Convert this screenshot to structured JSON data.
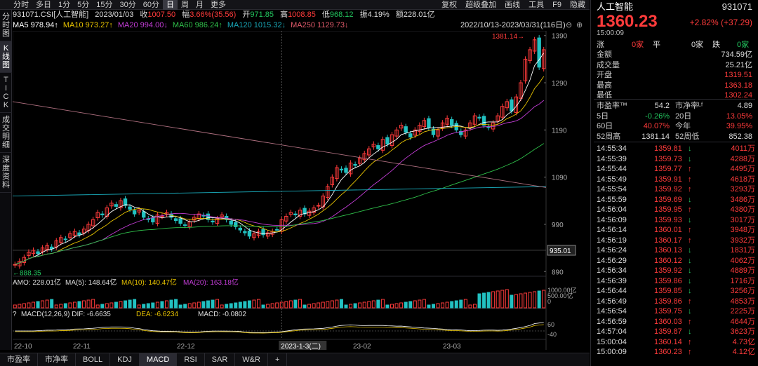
{
  "period_tabs": [
    "分时",
    "多日",
    "1分",
    "5分",
    "15分",
    "30分",
    "60分",
    "日",
    "周",
    "月",
    "更多"
  ],
  "active_period": "日",
  "toolbar": [
    "复权",
    "超级叠加",
    "画线",
    "工具",
    "F9",
    "隐藏"
  ],
  "left_nav": [
    "分\n时\n图",
    "K\n线\n图",
    "T\nI\nC\nK",
    "成\n交\n明\n细",
    "深\n度\n资\n料"
  ],
  "info": {
    "code": "931071.CSI[人工智能]",
    "date": "2023/01/03",
    "close_label": "收",
    "close": "1007.50",
    "amp_label": "幅",
    "amp": "3.66%(35.56)",
    "open_label": "开",
    "open": "971.85",
    "high_label": "高",
    "high": "1008.85",
    "low_label": "低",
    "low": "968.12",
    "swing": "振4.19%",
    "amount": "额228.01亿"
  },
  "ma": {
    "ma5": "MA5 978.94↑",
    "ma10": "MA10 973.27↑",
    "ma20": "MA20 994.00↓",
    "ma60": "MA60 986.24↑",
    "ma120": "MA120 1015.32↓",
    "ma250": "MA250 1129.73↓"
  },
  "range_label": "2022/10/13-2023/03/31(116日)",
  "price_axis": [
    "1390",
    "1290",
    "1190",
    "1090",
    "990",
    "890"
  ],
  "current_price_tag": "935.01",
  "high_annot": "1381.14",
  "low_annot": "888.35",
  "amo": {
    "amo": "AMO: 228.01亿",
    "ma5": "MA(5): 148.64亿",
    "ma10": "MA(10): 140.47亿",
    "ma20": "MA(20): 163.18亿"
  },
  "vol_axis": [
    "1000.00亿",
    "500.00亿",
    "0"
  ],
  "macd": {
    "q": "?",
    "label": "MACD(12,26,9) DIF: -6.6635",
    "dea": "DEA: -6.6234",
    "macd": "MACD: -0.0802"
  },
  "macd_axis": [
    "60",
    "-40"
  ],
  "date_axis": [
    "22-10",
    "22-11",
    "22-12",
    "23-02",
    "23-03"
  ],
  "date_highlight": "2023-1-3(二)",
  "bottom_tabs": [
    "市盈率",
    "市净率",
    "BOLL",
    "KDJ",
    "MACD",
    "RSI",
    "SAR",
    "W&R",
    "+"
  ],
  "active_bottom": "MACD",
  "stock": {
    "name": "人工智能",
    "code": "931071",
    "price": "1360.23",
    "change": "+2.82%",
    "change_pts": "(+37.29)",
    "time": "15:00:09"
  },
  "stats": {
    "zhang": "涨",
    "zhang_v": "0家",
    "ping": "平",
    "ping_v": "0家",
    "die": "跌",
    "die_v": "0家",
    "rows": [
      [
        "金额",
        "734.59亿"
      ],
      [
        "成交量",
        "25.21亿"
      ],
      [
        "开盘",
        "1319.51"
      ],
      [
        "最高",
        "1363.18"
      ],
      [
        "最低",
        "1302.24"
      ]
    ],
    "pe": "市盈率™",
    "pe_v": "54.2",
    "pb": "市净率ᴸᶠ",
    "pb_v": "4.89",
    "d5": "5日",
    "d5_v": "-0.26%",
    "d20": "20日",
    "d20_v": "13.05%",
    "d60": "60日",
    "d60_v": "40.07%",
    "ytd": "今年",
    "ytd_v": "39.95%",
    "w52h": "52周高",
    "w52h_v": "1381.14",
    "w52l": "52周低",
    "w52l_v": "852.38"
  },
  "ticks": [
    [
      "14:55:34",
      "1359.81",
      "↓",
      "4011万"
    ],
    [
      "14:55:39",
      "1359.73",
      "↓",
      "4288万"
    ],
    [
      "14:55:44",
      "1359.77",
      "↑",
      "4495万"
    ],
    [
      "14:55:49",
      "1359.91",
      "↑",
      "4618万"
    ],
    [
      "14:55:54",
      "1359.92",
      "↑",
      "3293万"
    ],
    [
      "14:55:59",
      "1359.69",
      "↓",
      "3486万"
    ],
    [
      "14:56:04",
      "1359.95",
      "↑",
      "4380万"
    ],
    [
      "14:56:09",
      "1359.93",
      "↓",
      "3017万"
    ],
    [
      "14:56:14",
      "1360.01",
      "↑",
      "3948万"
    ],
    [
      "14:56:19",
      "1360.17",
      "↑",
      "3932万"
    ],
    [
      "14:56:24",
      "1360.13",
      "↓",
      "1831万"
    ],
    [
      "14:56:29",
      "1360.12",
      "↓",
      "4062万"
    ],
    [
      "14:56:34",
      "1359.92",
      "↓",
      "4889万"
    ],
    [
      "14:56:39",
      "1359.86",
      "↓",
      "1716万"
    ],
    [
      "14:56:44",
      "1359.85",
      "↓",
      "3256万"
    ],
    [
      "14:56:49",
      "1359.86",
      "↑",
      "4853万"
    ],
    [
      "14:56:54",
      "1359.75",
      "↓",
      "2225万"
    ],
    [
      "14:56:59",
      "1360.03",
      "↑",
      "4644万"
    ],
    [
      "14:57:04",
      "1359.87",
      "↓",
      "3623万"
    ],
    [
      "15:00:04",
      "1360.14",
      "↑",
      "4.73亿"
    ],
    [
      "15:00:09",
      "1360.23",
      "↑",
      "4.12亿"
    ]
  ],
  "colors": {
    "up": "#ff3b3b",
    "down": "#22c1c1",
    "ma5": "#ffffff",
    "ma10": "#e6c200",
    "ma20": "#c33dd6",
    "ma60": "#2fbf4a",
    "ma120": "#19a8b8",
    "ma250": "#b07080"
  },
  "chart_data": {
    "type": "candlestick",
    "days": 116,
    "start": "2022/10/13",
    "end": "2023/03/31",
    "y_range": [
      880,
      1400
    ],
    "closes": [
      905,
      912,
      920,
      931,
      935,
      928,
      940,
      945,
      938,
      955,
      962,
      958,
      970,
      975,
      968,
      980,
      990,
      1000,
      1015,
      1010,
      1025,
      1035,
      1028,
      1040,
      1030,
      1022,
      1012,
      1020,
      1005,
      1000,
      995,
      1010,
      1008,
      1015,
      1005,
      998,
      992,
      988,
      995,
      1005,
      1012,
      1008,
      1000,
      995,
      1002,
      1010,
      1000,
      990,
      985,
      978,
      972,
      965,
      970,
      975,
      968,
      972,
      975,
      978,
      1000,
      1007,
      1015,
      1010,
      1020,
      1012,
      1018,
      1025,
      1030,
      1050,
      1070,
      1090,
      1110,
      1105,
      1100,
      1120,
      1115,
      1130,
      1140,
      1150,
      1160,
      1150,
      1170,
      1160,
      1180,
      1190,
      1200,
      1185,
      1175,
      1190,
      1200,
      1210,
      1195,
      1180,
      1190,
      1205,
      1215,
      1200,
      1190,
      1180,
      1190,
      1205,
      1220,
      1215,
      1200,
      1195,
      1205,
      1220,
      1240,
      1250,
      1230,
      1260,
      1290,
      1340,
      1360,
      1381,
      1323,
      1360
    ]
  }
}
